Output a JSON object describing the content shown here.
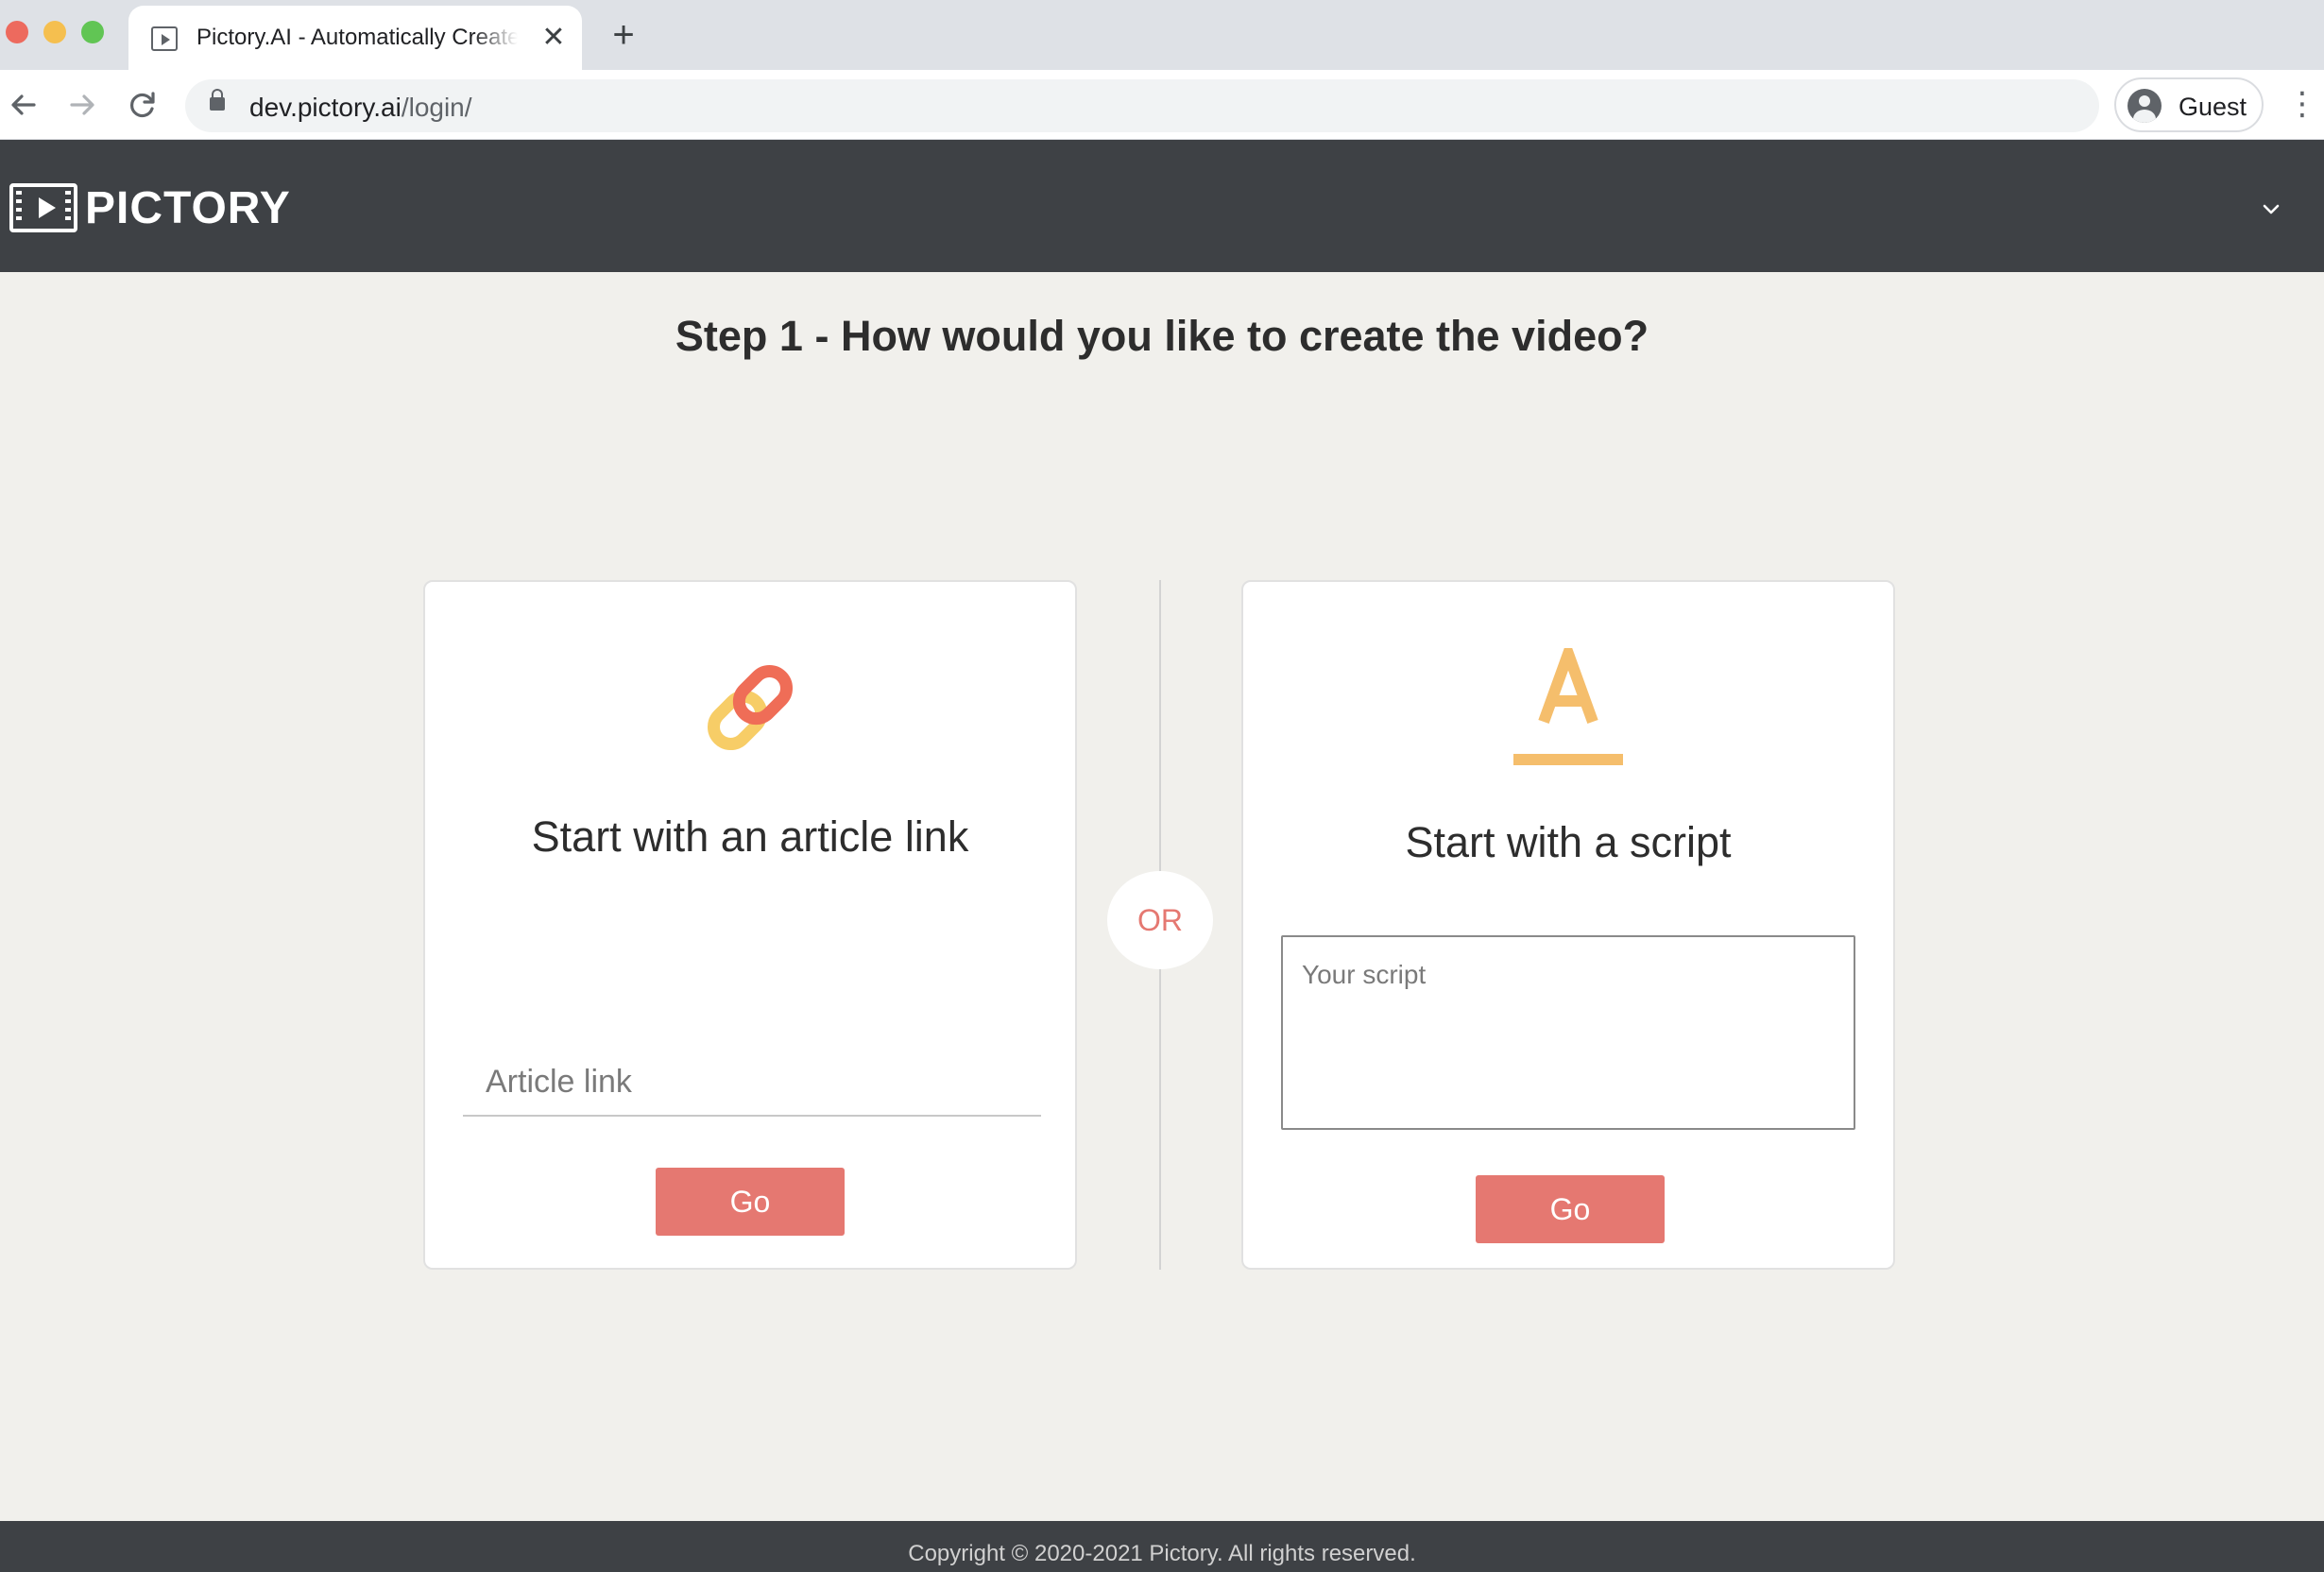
{
  "browser": {
    "tab": {
      "title": "Pictory.AI - Automatically Create",
      "close_glyph": "✕"
    },
    "new_tab_glyph": "+",
    "url": {
      "host": "dev.pictory.ai",
      "path": "/login/"
    },
    "profile": {
      "name": "Guest"
    },
    "menu_glyph": "⋮"
  },
  "header": {
    "logo_text": "PICTORY"
  },
  "main": {
    "step_title": "Step 1 - How would you like to create the video?",
    "article_card": {
      "title": "Start with an article link",
      "input_placeholder": "Article link",
      "button_label": "Go",
      "icon": "link-icon",
      "icon_colors": {
        "top": "#ef6d57",
        "bottom": "#f7cd67"
      }
    },
    "or_label": "OR",
    "script_card": {
      "title": "Start with a script",
      "input_placeholder": "Your script",
      "button_label": "Go",
      "icon": "text-format-icon",
      "icon_color": "#f5be6c"
    }
  },
  "footer": {
    "copyright": "Copyright © 2020-2021 Pictory. All rights reserved."
  },
  "colors": {
    "header_bg": "#3e4145",
    "page_bg": "#f1f0ec",
    "accent": "#e57871"
  }
}
